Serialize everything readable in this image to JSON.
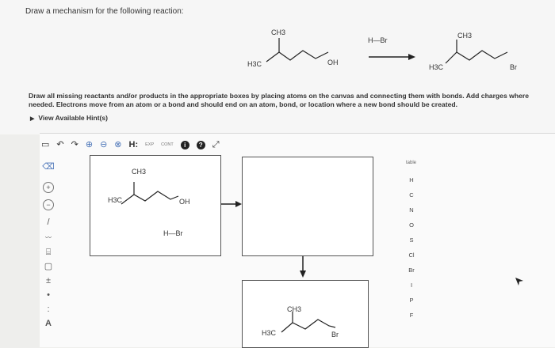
{
  "question": {
    "prompt": "Draw a mechanism for the following reaction:",
    "reactant": {
      "methyl_top": "CH3",
      "methyl_left": "H3C",
      "oh": "OH"
    },
    "reagent": "H—Br",
    "product": {
      "methyl_top": "CH3",
      "methyl_left": "H3C",
      "br": "Br"
    },
    "instructions": "Draw all missing reactants and/or products in the appropriate boxes by placing atoms on the canvas and connecting them with bonds. Add charges where needed. Electrons move from an atom or a bond and should end on an atom, bond, or location where a new bond should be created.",
    "hint_link": "View Available Hint(s)"
  },
  "editor": {
    "toolbar": [
      {
        "name": "new-document-icon",
        "glyph": "▭"
      },
      {
        "name": "undo-icon",
        "glyph": "↶"
      },
      {
        "name": "redo-icon",
        "glyph": "↷"
      },
      {
        "name": "zoom-in-icon",
        "glyph": "⊕"
      },
      {
        "name": "zoom-out-icon",
        "glyph": "⊖"
      },
      {
        "name": "zoom-reset-icon",
        "glyph": "⊗"
      },
      {
        "name": "lone-pair-tool-icon",
        "glyph": "H:"
      },
      {
        "name": "exp-label",
        "glyph": "EXP"
      },
      {
        "name": "cont-label",
        "glyph": "CONT"
      },
      {
        "name": "info-icon",
        "glyph": "i"
      },
      {
        "name": "help-icon",
        "glyph": "?"
      },
      {
        "name": "fullscreen-icon",
        "glyph": "⤢"
      }
    ],
    "left_tools": [
      {
        "name": "eraser-tool-icon",
        "glyph": "⌫"
      },
      {
        "name": "positive-charge-icon",
        "glyph": "+"
      },
      {
        "name": "negative-charge-icon",
        "glyph": "−"
      },
      {
        "name": "single-bond-tool-icon",
        "glyph": "/"
      },
      {
        "name": "chain-tool-icon",
        "glyph": "〰"
      },
      {
        "name": "template-tool-icon",
        "glyph": "⌸"
      },
      {
        "name": "ring-tool-icon",
        "glyph": "▢"
      },
      {
        "name": "charge-tool-icon",
        "glyph": "±"
      },
      {
        "name": "radical-tool-icon",
        "glyph": "•"
      },
      {
        "name": "lone-pair-icon",
        "glyph": ":"
      },
      {
        "name": "text-tool-icon",
        "glyph": "A"
      }
    ],
    "box1": {
      "methyl_top": "CH3",
      "methyl_left": "H3C",
      "oh": "OH",
      "hbr": "H—Br"
    },
    "box3": {
      "methyl_top": "CH3",
      "methyl_left": "H3C",
      "br": "Br"
    },
    "atoms": [
      "H",
      "C",
      "N",
      "O",
      "S",
      "Cl",
      "Br",
      "I",
      "P",
      "F"
    ],
    "periodic_label": "table"
  }
}
